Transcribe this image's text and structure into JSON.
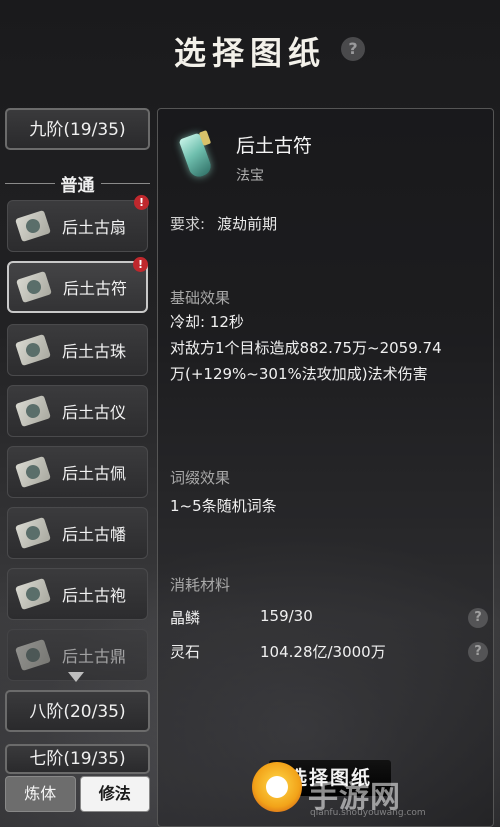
{
  "header": {
    "title": "选择图纸",
    "help_icon": "?"
  },
  "left": {
    "current_grade": "九阶(19/35)",
    "section_label": "普通",
    "items": [
      {
        "label": "后土古扇",
        "alert": "!"
      },
      {
        "label": "后土古符",
        "alert": "!"
      },
      {
        "label": "后土古珠"
      },
      {
        "label": "后土古仪"
      },
      {
        "label": "后土古佩"
      },
      {
        "label": "后土古幡"
      },
      {
        "label": "后土古袍"
      },
      {
        "label": "后土古鼎"
      }
    ],
    "grade_8": "八阶(20/35)",
    "grade_7": "七阶(19/35)",
    "tabs": [
      {
        "label": "炼体",
        "active": false
      },
      {
        "label": "修法",
        "active": true
      }
    ]
  },
  "detail": {
    "name": "后土古符",
    "type": "法宝",
    "requirement_label": "要求:",
    "requirement_value": "渡劫前期",
    "base_effect_title": "基础效果",
    "cooldown": "冷却: 12秒",
    "effect_line1": "对敌方1个目标造成882.75万~2059.74",
    "effect_line2": "万(+129%~301%法攻加成)法术伤害",
    "affix_title": "词缀效果",
    "affix_text": "1~5条随机词条",
    "materials_title": "消耗材料",
    "materials": [
      {
        "name": "晶鳞",
        "qty": "159/30",
        "help": "?"
      },
      {
        "name": "灵石",
        "qty": "104.28亿/3000万",
        "help": "?"
      }
    ]
  },
  "confirm_button": "选择图纸",
  "watermark": {
    "text": "手游网",
    "url": "qianfu.shouyouwang.com"
  }
}
